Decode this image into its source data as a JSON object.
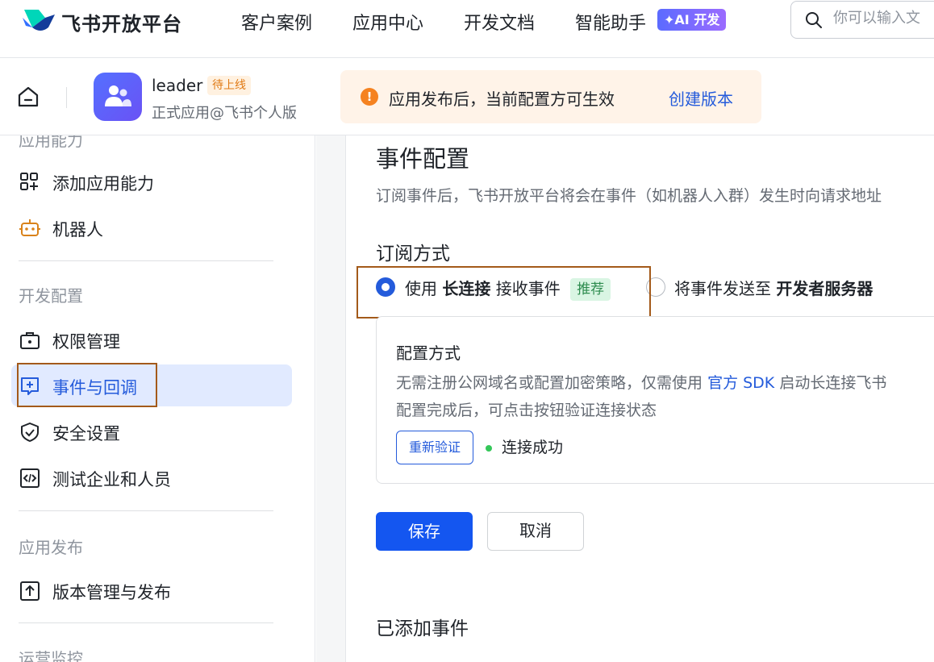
{
  "topnav": {
    "brand": "飞书开放平台",
    "links": [
      "客户案例",
      "应用中心",
      "开发文档",
      "智能助手"
    ],
    "ai_badge": "✦AI 开发",
    "search_placeholder": "你可以输入文"
  },
  "app": {
    "name": "leader",
    "status": "待上线",
    "subtitle": "正式应用@飞书个人版",
    "notice": "应用发布后，当前配置方可生效",
    "notice_link": "创建版本"
  },
  "sidebar": {
    "section_app": "应用能力",
    "app_items": [
      "添加应用能力",
      "机器人"
    ],
    "section_dev": "开发配置",
    "dev_items": [
      "权限管理",
      "事件与回调",
      "安全设置",
      "测试企业和人员"
    ],
    "section_release": "应用发布",
    "release_items": [
      "版本管理与发布"
    ],
    "section_ops": "运营监控"
  },
  "main": {
    "title": "事件配置",
    "description": "订阅事件后，飞书开放平台将会在事件（如机器人入群）发生时向请求地址",
    "subscribe_title": "订阅方式",
    "option1_pre": "使用",
    "option1_bold": "长连接",
    "option1_post": "接收事件",
    "option1_tag": "推荐",
    "option2_pre": "将事件发送至",
    "option2_bold": "开发者服务器",
    "card_title": "配置方式",
    "card_desc_pre": "无需注册公网域名或配置加密策略，仅需使用",
    "card_desc_link": "官方 SDK",
    "card_desc_post": "启动长连接飞书",
    "card_desc2": "配置完成后，可点击按钮验证连接状态",
    "reverify": "重新验证",
    "conn_status": "连接成功",
    "save": "保存",
    "cancel": "取消",
    "added_events_title": "已添加事件"
  }
}
